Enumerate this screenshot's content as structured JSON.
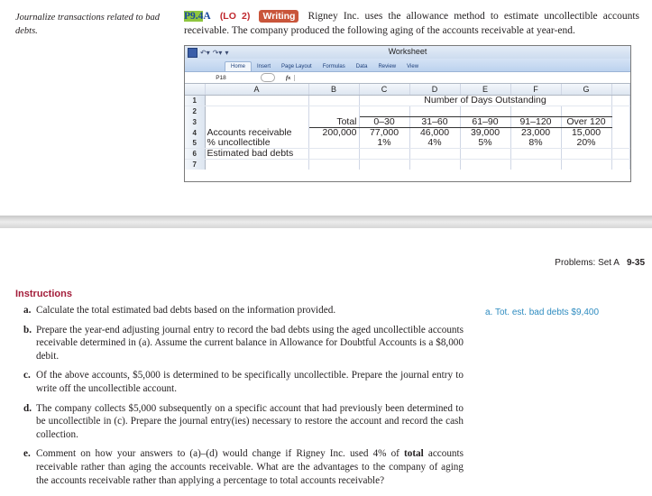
{
  "sidenote": "Journalize transactions related to bad debts.",
  "problem": {
    "number_highlight": "P9.4",
    "number_suffix": "A",
    "lo": "(LO 2)",
    "tag": "Writing",
    "intro": "Rigney Inc. uses the allowance method to estimate uncollectible accounts receivable. The company produced the following aging of the accounts receivable at year-end."
  },
  "worksheet": {
    "title": "Worksheet",
    "ribbon_tabs": [
      "Home",
      "Insert",
      "Page Layout",
      "Formulas",
      "Data",
      "Review",
      "View"
    ],
    "active_tab": "Home",
    "name_box": "P18",
    "fx_label": "fx",
    "columns": [
      "A",
      "B",
      "C",
      "D",
      "E",
      "F",
      "G"
    ],
    "rows": [
      "1",
      "2",
      "3",
      "4",
      "5",
      "6",
      "7"
    ],
    "group_header": "Number of Days Outstanding",
    "headers": [
      "",
      "Total",
      "0–30",
      "31–60",
      "61–90",
      "91–120",
      "Over 120"
    ],
    "accounts_receivable": [
      "Accounts receivable",
      "200,000",
      "77,000",
      "46,000",
      "39,000",
      "23,000",
      "15,000"
    ],
    "pct_uncollectible": [
      "% uncollectible",
      "",
      "1%",
      "4%",
      "5%",
      "8%",
      "20%"
    ],
    "estimated_bad_debts": [
      "Estimated bad debts",
      "",
      "",
      "",
      "",
      "",
      ""
    ]
  },
  "page_header": {
    "section": "Problems: Set A",
    "page": "9-35"
  },
  "instructions": {
    "heading": "Instructions",
    "items": [
      {
        "label": "a.",
        "text": "Calculate the total estimated bad debts based on the information provided."
      },
      {
        "label": "b.",
        "text": "Prepare the year-end adjusting journal entry to record the bad debts using the aged uncollectible accounts receivable determined in (a). Assume the current balance in Allowance for Doubtful Accounts is a $8,000 debit."
      },
      {
        "label": "c.",
        "text": "Of the above accounts, $5,000 is determined to be specifically uncollectible. Prepare the journal entry to write off the uncollectible account."
      },
      {
        "label": "d.",
        "text": "The company collects $5,000 subsequently on a specific account that had previously been determined to be uncollectible in (c). Prepare the journal entry(ies) necessary to restore the account and record the cash collection."
      },
      {
        "label": "e.",
        "text_before": "Comment on how your answers to (a)–(d) would change if Rigney Inc. used 4% of ",
        "text_bold": "total",
        "text_after": " accounts receivable rather than aging the accounts receivable. What are the advantages to the company of aging the accounts receivable rather than applying a percentage to total accounts receivable?"
      }
    ]
  },
  "answer": "a. Tot. est. bad debts $9,400",
  "colors": {
    "instructions_heading": "#a31d3a",
    "answer": "#2f8cc0",
    "writing_badge": "#c9553a",
    "problem_highlight": "#8fc63f"
  }
}
